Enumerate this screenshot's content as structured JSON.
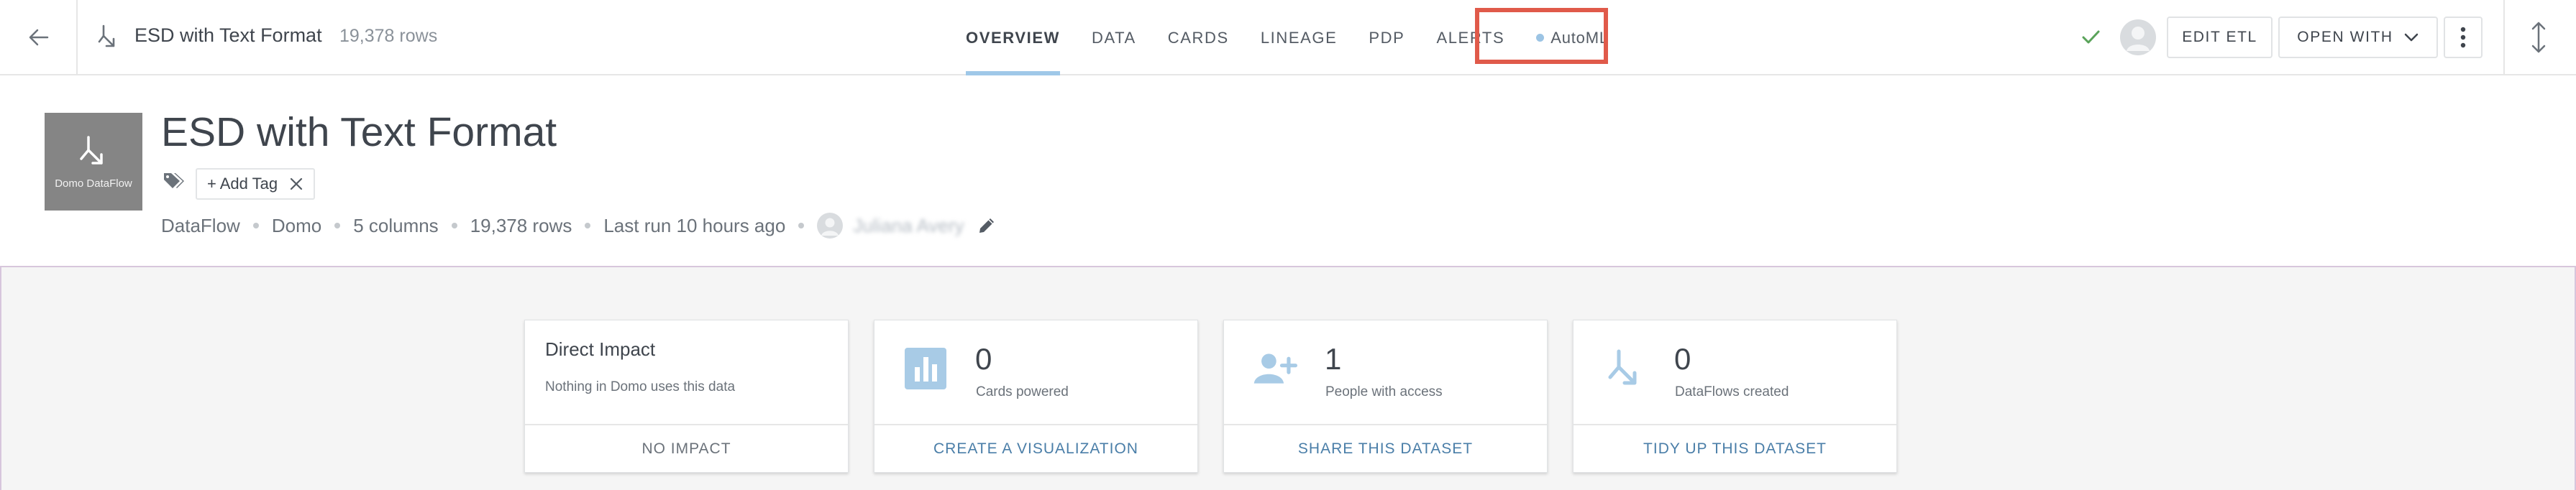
{
  "topbar": {
    "dataset_name": "ESD with Text Format",
    "row_count": "19,378 rows",
    "tabs": [
      {
        "label": "OVERVIEW",
        "active": true
      },
      {
        "label": "DATA",
        "active": false
      },
      {
        "label": "CARDS",
        "active": false
      },
      {
        "label": "LINEAGE",
        "active": false
      },
      {
        "label": "PDP",
        "active": false
      },
      {
        "label": "ALERTS",
        "active": false
      },
      {
        "label": "AutoML",
        "active": false,
        "highlighted": true
      }
    ],
    "edit_etl_label": "EDIT ETL",
    "open_with_label": "OPEN WITH",
    "status_icon": "check-icon",
    "highlight_color": "#e05a4a",
    "accent_color": "#9fc8e8"
  },
  "header": {
    "tile_label": "Domo DataFlow",
    "title": "ESD with Text Format",
    "add_tag_label": "+ Add Tag",
    "meta": {
      "type": "DataFlow",
      "source": "Domo",
      "columns": "5 columns",
      "rows": "19,378 rows",
      "last_run": "Last run 10 hours ago",
      "owner": "Juliana Avery"
    }
  },
  "cards": {
    "impact": {
      "title": "Direct Impact",
      "description": "Nothing in Domo uses this data",
      "footer": "NO IMPACT"
    },
    "cards_powered": {
      "value": "0",
      "label": "Cards powered",
      "footer": "CREATE A VISUALIZATION",
      "icon": "bar-chart-icon"
    },
    "people_access": {
      "value": "1",
      "label": "People with access",
      "footer": "SHARE THIS DATASET",
      "icon": "add-person-icon"
    },
    "dataflows_created": {
      "value": "0",
      "label": "DataFlows created",
      "footer": "TIDY UP THIS DATASET",
      "icon": "dataflow-icon"
    }
  }
}
